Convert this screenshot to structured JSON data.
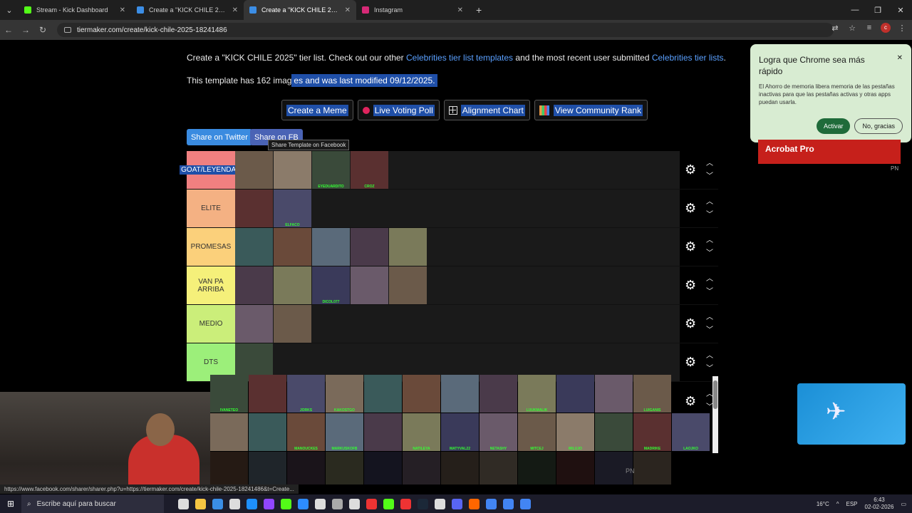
{
  "browser": {
    "tabs": [
      {
        "title": "Stream - Kick Dashboard",
        "color": "#53fc18",
        "active": false
      },
      {
        "title": "Create a \"KICK CHILE 2025\" Tie",
        "color": "#3c8ee6",
        "active": false
      },
      {
        "title": "Create a \"KICK CHILE 2025\" Tie",
        "color": "#3c8ee6",
        "active": true
      },
      {
        "title": "Instagram",
        "color": "#d62976",
        "active": false
      }
    ],
    "url": "tiermaker.com/create/kick-chile-2025-18241486",
    "status_url": "https://www.facebook.com/sharer/sharer.php?u=https://tiermaker.com/create/kick-chile-2025-18241486&t=Create..."
  },
  "intro": {
    "prefix": "Create a \"KICK CHILE 2025\" tier list. Check out our other ",
    "link1": "Celebrities tier list templates",
    "mid": " and the most recent user submitted ",
    "link2": "Celebrities tier lists",
    "suffix": "."
  },
  "template_info": {
    "plain": "This template has 162 imag",
    "selected": "es and was last modified 09/12/2025."
  },
  "actions": {
    "meme": "Create a Meme",
    "poll": "Live Voting Poll",
    "alignment": "Alignment Chart",
    "community": "View Community Rank"
  },
  "share": {
    "twitter": "Share on Twitter",
    "facebook": "Share on FB",
    "tooltip": "Share Template on Facebook"
  },
  "tiers": [
    {
      "label": "GOAT/LEYENDAS",
      "color": "#f08080",
      "selected": true,
      "items": [
        "",
        "",
        "EYEDUARDITO",
        "CROZ"
      ]
    },
    {
      "label": "ELITE",
      "color": "#f4b183",
      "selected": false,
      "items": [
        "",
        "ELFACO"
      ]
    },
    {
      "label": "PROMESAS",
      "color": "#fbd07b",
      "selected": false,
      "items": [
        "",
        "",
        "",
        "",
        ""
      ]
    },
    {
      "label": "VAN PA ARRIBA",
      "color": "#f5f07a",
      "selected": false,
      "items": [
        "",
        "",
        "DICOL077",
        "",
        ""
      ]
    },
    {
      "label": "MEDIO",
      "color": "#cbee7a",
      "selected": false,
      "items": [
        "",
        ""
      ]
    },
    {
      "label": "DTS",
      "color": "#9cef7a",
      "selected": false,
      "items": [
        ""
      ]
    }
  ],
  "pool_row1": [
    "IVANETEO",
    "",
    "JORKS",
    "KAKOSTGO",
    "",
    "",
    "",
    "",
    "LUUKMALIK",
    "",
    "",
    "LUIGANIS"
  ],
  "pool_row2": [
    "",
    "",
    "MANOUCKES",
    "MARKUSKOFB",
    "",
    "NATILEYA",
    "MATYVAL22",
    "NETASHY",
    "MITCEJ",
    "MILUJO",
    "",
    "MADRIKE",
    "LAOJKO"
  ],
  "popup": {
    "title": "Logra que Chrome sea más rápido",
    "body": "El Ahorro de memoria libera memoria de las pestañas inactivas para que las pestañas activas y otras apps puedan usarla.",
    "accept": "Activar",
    "decline": "No, gracias"
  },
  "ad": {
    "text": "Acrobat Pro",
    "label": "PN",
    "label2": "PN"
  },
  "taskbar": {
    "search": "Escribe aquí para buscar",
    "temp": "16°C",
    "lang": "ESP",
    "time": "6:43",
    "date": "02-02-2026"
  }
}
